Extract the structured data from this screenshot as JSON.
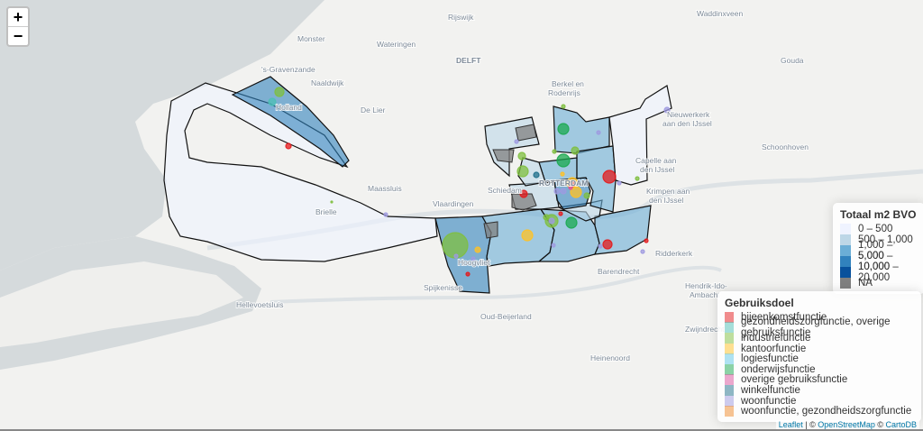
{
  "zoom": {
    "in_label": "+",
    "out_label": "−"
  },
  "places": {
    "rijswijk": "Rijswijk",
    "waddinxveen": "Waddinxveen",
    "monster": "Monster",
    "wateringen": "Wateringen",
    "delft": "DELFT",
    "gouda": "Gouda",
    "gravenzande": "'s-Gravenzande",
    "naaldwijk": "Naaldwijk",
    "berkel1": "Berkel en",
    "berkel2": "Rodenrijs",
    "delier": "De Lier",
    "hoek": "Holland",
    "nieuwerkerk1": "Nieuwerkerk",
    "nieuwerkerk2": "aan den IJssel",
    "schoonhoven": "Schoonhoven",
    "capelle1": "Capelle aan",
    "capelle2": "den IJssel",
    "maassluis": "Maassluis",
    "schiedam": "Schiedam",
    "vlaardingen": "Vlaardingen",
    "rotterdam": "ROTTERDAM",
    "krimpen1": "Krimpen aan",
    "krimpen2": "den IJssel",
    "brielle": "Brielle",
    "hoogvliet": "Hoogvliet",
    "ridderkerk": "Ridderkerk",
    "barendrecht": "Barendrecht",
    "spijkenisse": "Spijkenisse",
    "hellevoetsluis": "Hellevoetsluis",
    "oudbeijerland": "Oud-Beijerland",
    "hendrik1": "Hendrik-Ido-",
    "hendrik2": "Ambacht",
    "zwijndrecht": "Zwijndrecht",
    "hoogwerf": "Heinenoord"
  },
  "legend_bvo": {
    "title": "Totaal m2 BVO",
    "items": [
      {
        "label": "0 – 500",
        "color": "#eff3ff"
      },
      {
        "label": "500 – 1,000",
        "color": "#bdd7e7"
      },
      {
        "label": "1,000 – 5,000",
        "color": "#6baed6"
      },
      {
        "label": "5,000 – 10,000",
        "color": "#3182bd"
      },
      {
        "label": "10,000 – 20,000",
        "color": "#08519c"
      },
      {
        "label": "NA",
        "color": "#808080"
      }
    ]
  },
  "legend_doel": {
    "title": "Gebruiksdoel",
    "items": [
      {
        "label": "bijeenkomstfunctie",
        "color": "#e41a1c"
      },
      {
        "label": "gezondheidszorgfunctie, overige gebruiksfunctie",
        "color": "#4dc0b5"
      },
      {
        "label": "industriefunctie",
        "color": "#7fbf3f"
      },
      {
        "label": "kantoorfunctie",
        "color": "#ffc125"
      },
      {
        "label": "logiesfunctie",
        "color": "#5fc8e8"
      },
      {
        "label": "onderwijsfunctie",
        "color": "#1aa84f"
      },
      {
        "label": "overige gebruiksfunctie",
        "color": "#d9519e"
      },
      {
        "label": "winkelfunctie",
        "color": "#1f6f8b"
      },
      {
        "label": "woonfunctie",
        "color": "#9e9ae0"
      },
      {
        "label": "woonfunctie, gezondheidszorgfunctie",
        "color": "#f08a2a"
      }
    ]
  },
  "attribution": {
    "leaflet": "Leaflet",
    "sep1": " | © ",
    "osm": "OpenStreetMap",
    "sep2": " © ",
    "carto": "CartoDB"
  }
}
